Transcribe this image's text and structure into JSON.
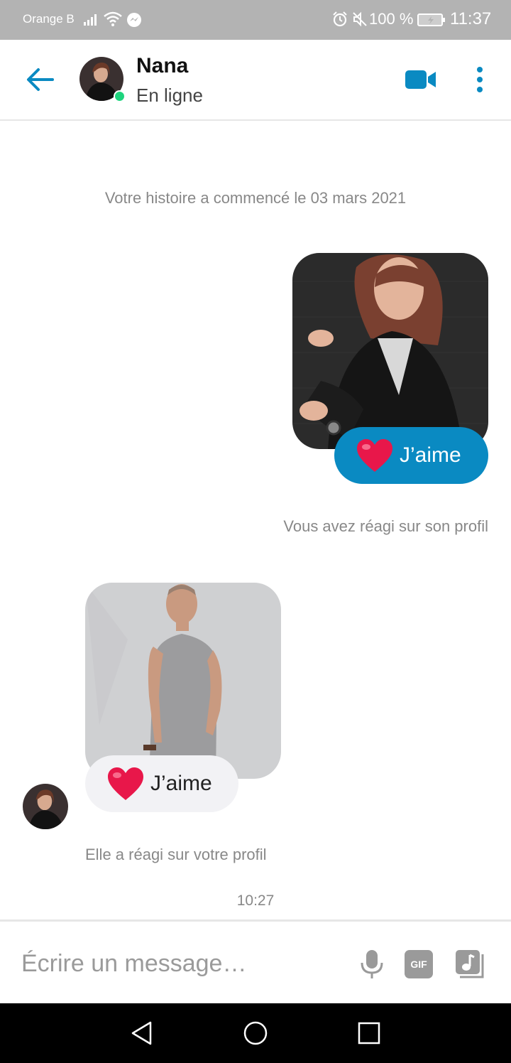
{
  "status_bar": {
    "carrier": "Orange B",
    "battery": "100 %",
    "time": "11:37",
    "icons": [
      "signal-icon",
      "wifi-icon",
      "messenger-icon",
      "alarm-icon",
      "mute-icon",
      "battery-icon"
    ]
  },
  "header": {
    "name": "Nana",
    "status": "En ligne",
    "online_color": "#1ed47e",
    "accent_color": "#0a8ac2"
  },
  "chat": {
    "history_start": "Votre histoire a commencé le 03 mars 2021",
    "sent_reaction": {
      "label": "J’aime",
      "note": "Vous avez réagi sur son profil",
      "bubble_color": "#0a8ac2"
    },
    "received_reaction": {
      "label": "J’aime",
      "note": "Elle a réagi sur votre profil",
      "bubble_color": "#f2f2f5"
    },
    "time": "10:27"
  },
  "composer": {
    "placeholder": "Écrire un message…",
    "gif_label": "GIF"
  }
}
